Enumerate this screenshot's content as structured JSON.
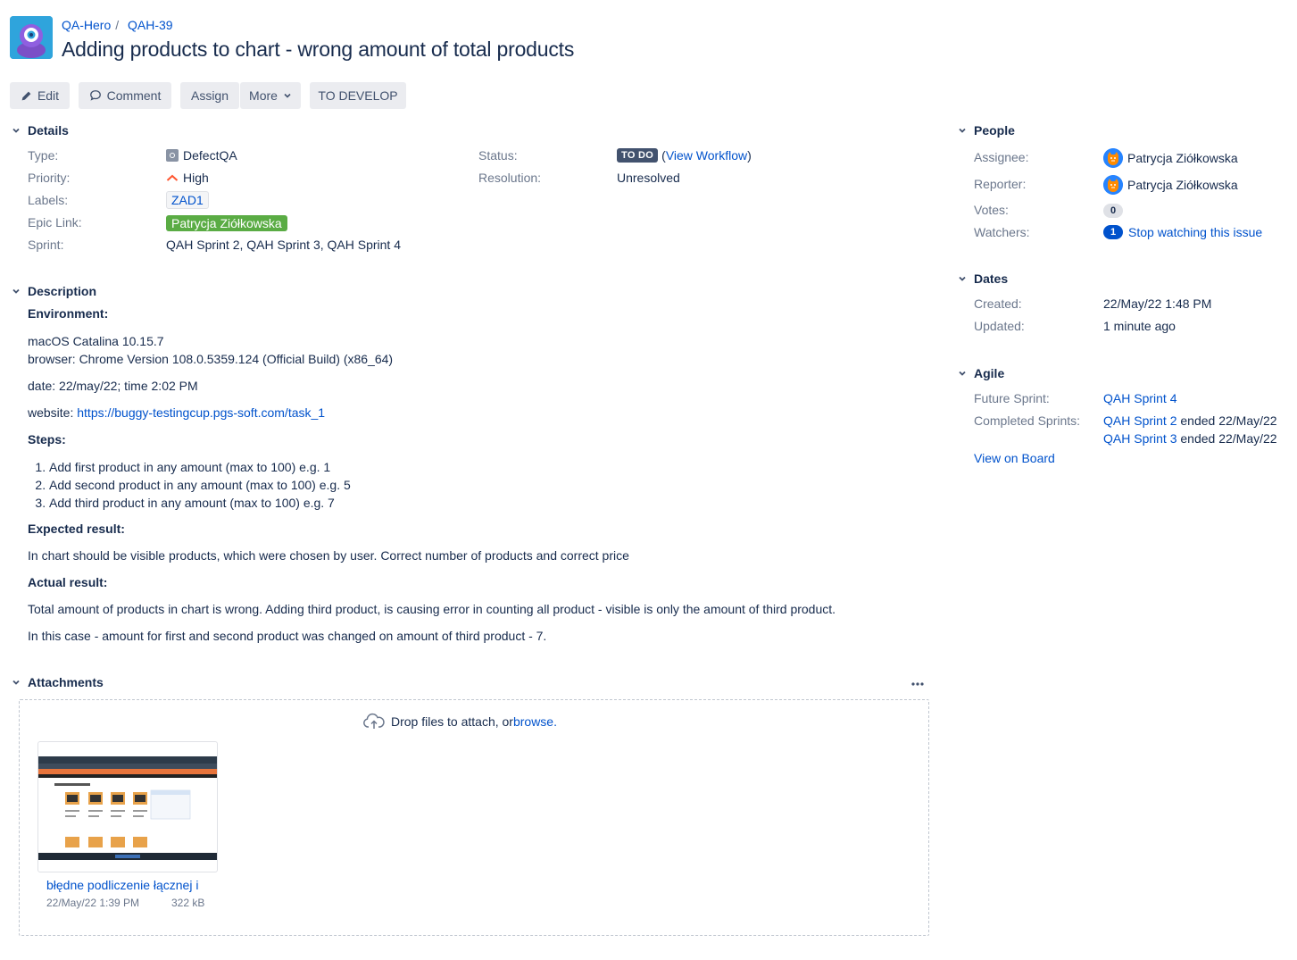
{
  "header": {
    "project": "QA-Hero",
    "issue_key": "QAH-39",
    "title": "Adding products to chart - wrong amount of total products"
  },
  "toolbar": {
    "edit": "Edit",
    "comment": "Comment",
    "assign": "Assign",
    "more": "More",
    "transition": "TO DEVELOP"
  },
  "details": {
    "heading": "Details",
    "type_label": "Type:",
    "type_value": "DefectQA",
    "priority_label": "Priority:",
    "priority_value": "High",
    "labels_label": "Labels:",
    "labels_value": "ZAD1",
    "epic_label": "Epic Link:",
    "epic_value": "Patrycja Ziółkowska",
    "sprint_label": "Sprint:",
    "sprint_value": "QAH Sprint 2, QAH Sprint 3, QAH Sprint 4",
    "status_label": "Status:",
    "status_value": "TO DO",
    "view_workflow": "View Workflow",
    "resolution_label": "Resolution:",
    "resolution_value": "Unresolved"
  },
  "description": {
    "heading": "Description",
    "environment_heading": "Environment:",
    "os": "macOS Catalina 10.15.7",
    "browser": "browser: Chrome Version 108.0.5359.124 (Official Build) (x86_64)",
    "date": "date: 22/may/22; time 2:02 PM",
    "website_label": "website: ",
    "website_url": "https://buggy-testingcup.pgs-soft.com/task_1",
    "steps_heading": "Steps:",
    "steps": [
      "Add first product in any amount (max to 100) e.g. 1",
      "Add second product in any amount (max to 100) e.g. 5",
      "Add third product in any amount (max to 100) e.g. 7"
    ],
    "expected_heading": "Expected result:",
    "expected_text": "In chart should be visible products, which were chosen by user. Correct number of products and correct price",
    "actual_heading": "Actual result:",
    "actual_text_1": "Total amount of products in chart is wrong. Adding third product, is causing error in counting all product - visible is only the amount of third product.",
    "actual_text_2": "In this case - amount for first and second product was changed on amount of third product - 7."
  },
  "attachments": {
    "heading": "Attachments",
    "drop_text": "Drop files to attach, or ",
    "browse": "browse.",
    "files": [
      {
        "name": "błędne podliczenie łącznej i",
        "date": "22/May/22 1:39 PM",
        "size": "322 kB"
      }
    ]
  },
  "people": {
    "heading": "People",
    "assignee_label": "Assignee:",
    "assignee": "Patrycja Ziółkowska",
    "reporter_label": "Reporter:",
    "reporter": "Patrycja Ziółkowska",
    "votes_label": "Votes:",
    "votes": "0",
    "watchers_label": "Watchers:",
    "watchers": "1",
    "stop_watching": "Stop watching this issue"
  },
  "dates": {
    "heading": "Dates",
    "created_label": "Created:",
    "created": "22/May/22 1:48 PM",
    "updated_label": "Updated:",
    "updated": "1 minute ago"
  },
  "agile": {
    "heading": "Agile",
    "future_label": "Future Sprint:",
    "future": "QAH Sprint 4",
    "completed_label": "Completed Sprints:",
    "completed": [
      {
        "sprint": "QAH Sprint 2",
        "ended": " ended 22/May/22"
      },
      {
        "sprint": "QAH Sprint 3",
        "ended": " ended 22/May/22"
      }
    ],
    "view_board": "View on Board"
  },
  "colors": {
    "link": "#0052cc",
    "text": "#172b4d",
    "muted": "#6b778c",
    "button_bg": "#ebecf0",
    "epic_green": "#5aac44",
    "status_todo": "#42526e",
    "priority_high": "#ff5630"
  }
}
